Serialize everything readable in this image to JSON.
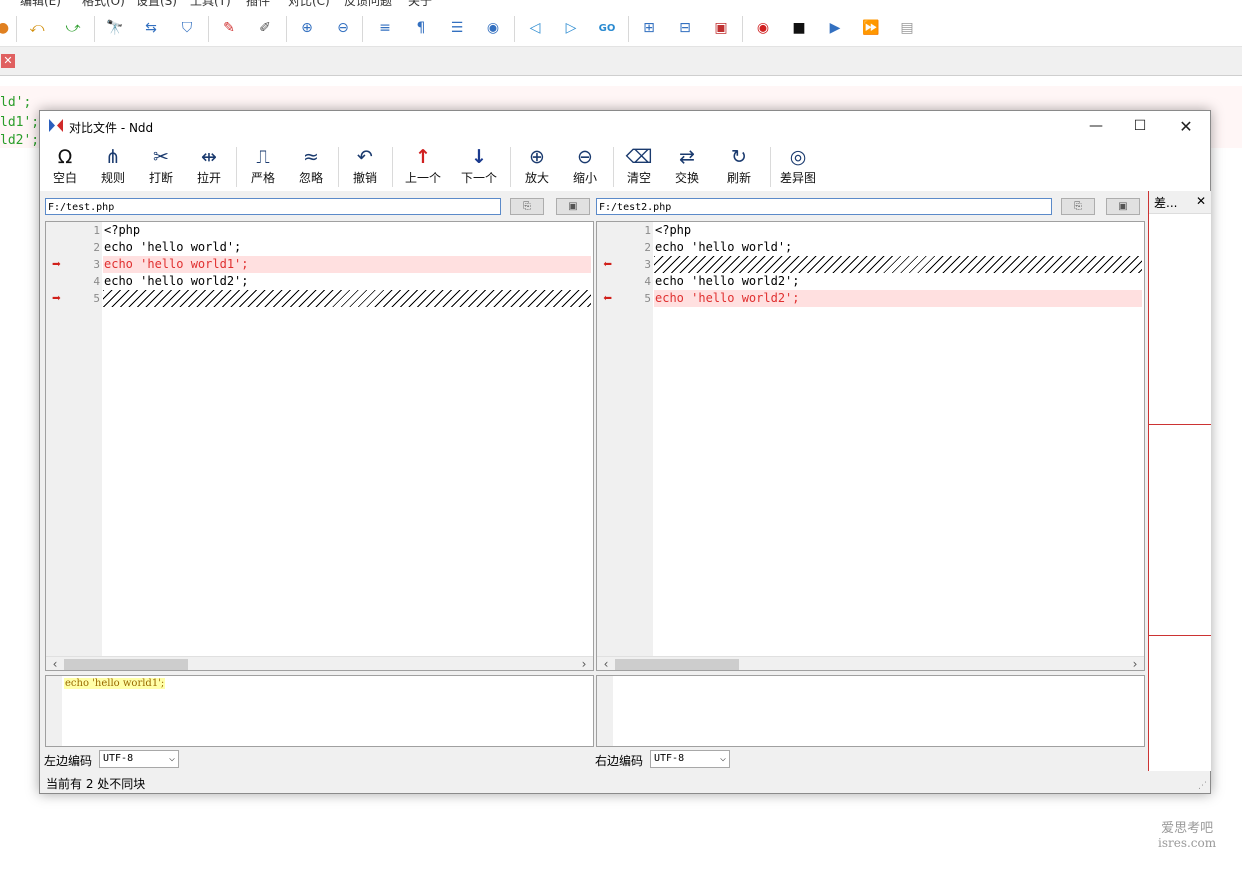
{
  "background_editor": {
    "menu_items": [
      "编辑(E)",
      "格式(O)",
      "设置(S)",
      "工具(T)",
      "插件",
      "对比(C)",
      "反馈问题",
      "关于"
    ],
    "code_lines": [
      "ld';",
      "ld1';",
      "ld2';"
    ]
  },
  "dialog": {
    "title": "对比文件 - Ndd",
    "window_controls": {
      "minimize": "—",
      "maximize": "☐",
      "close": "✕"
    },
    "toolbar": [
      {
        "label": "空白",
        "icon": "Ω"
      },
      {
        "label": "规则",
        "icon": "⋔"
      },
      {
        "label": "打断",
        "icon": "✂"
      },
      {
        "label": "拉开",
        "icon": "⇹"
      },
      {
        "label": "严格",
        "icon": "⎍"
      },
      {
        "label": "忽略",
        "icon": "≈"
      },
      {
        "label": "撤销",
        "icon": "↶"
      },
      {
        "label": "上一个",
        "icon": "↑"
      },
      {
        "label": "下一个",
        "icon": "↓"
      },
      {
        "label": "放大",
        "icon": "⊕"
      },
      {
        "label": "缩小",
        "icon": "⊖"
      },
      {
        "label": "清空",
        "icon": "⌫"
      },
      {
        "label": "交换",
        "icon": "⇄"
      },
      {
        "label": "刷新",
        "icon": "↻"
      },
      {
        "label": "差异图",
        "icon": "◎"
      }
    ],
    "left": {
      "path": "F:/test.php",
      "lines": [
        {
          "num": "1",
          "text": "<?php",
          "state": "same"
        },
        {
          "num": "2",
          "text": "echo 'hello world';",
          "state": "same"
        },
        {
          "num": "3",
          "text": "echo 'hello world1';",
          "state": "diff"
        },
        {
          "num": "4",
          "text": "echo 'hello world2';",
          "state": "same"
        },
        {
          "num": "5",
          "text": "",
          "state": "blank"
        }
      ],
      "detail_text": "echo 'hello world1';",
      "encoding_label": "左边编码",
      "encoding_value": "UTF-8"
    },
    "right": {
      "path": "F:/test2.php",
      "lines": [
        {
          "num": "1",
          "text": "<?php",
          "state": "same"
        },
        {
          "num": "2",
          "text": "echo 'hello world';",
          "state": "same"
        },
        {
          "num": "3",
          "text": "",
          "state": "blank"
        },
        {
          "num": "4",
          "text": "echo 'hello world2';",
          "state": "same"
        },
        {
          "num": "5",
          "text": "echo 'hello world2';",
          "state": "diff"
        }
      ],
      "detail_text": "",
      "encoding_label": "右边编码",
      "encoding_value": "UTF-8"
    },
    "side_panel": {
      "title": "差...",
      "close": "✕"
    },
    "status": "当前有 2 处不同块"
  },
  "watermark": {
    "line1": "爱思考吧",
    "line2": "isres.com"
  },
  "colors": {
    "diff_text": "#e03030",
    "diff_bg": "#ffe0e0",
    "arrow": "#d0201a",
    "path_border": "#5b8ac9"
  }
}
